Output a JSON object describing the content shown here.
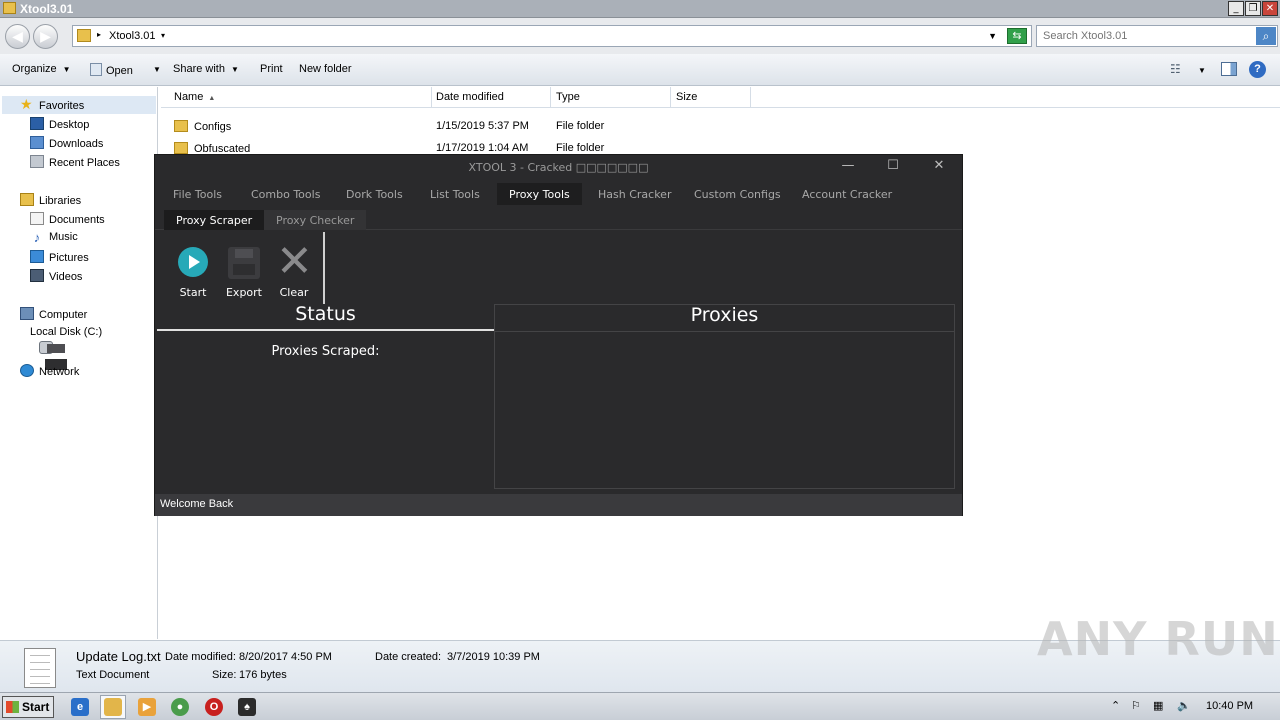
{
  "explorer": {
    "title": "Xtool3.01",
    "winbtns": {
      "minimize": "_",
      "restore": "❐",
      "close": "✕"
    },
    "address": {
      "path": "Xtool3.01",
      "search_placeholder": "Search Xtool3.01"
    },
    "command_bar": {
      "organize": "Organize",
      "open": "Open",
      "share_with": "Share with",
      "print": "Print",
      "new_folder": "New folder"
    },
    "nav": {
      "favorites": "Favorites",
      "desktop": "Desktop",
      "downloads": "Downloads",
      "recent_places": "Recent Places",
      "libraries": "Libraries",
      "documents": "Documents",
      "music": "Music",
      "pictures": "Pictures",
      "videos": "Videos",
      "computer": "Computer",
      "local_disk": "Local Disk (C:)",
      "network": "Network"
    },
    "columns": {
      "name": "Name",
      "date_modified": "Date modified",
      "type": "Type",
      "size": "Size"
    },
    "files": [
      {
        "name": "Configs",
        "date": "1/15/2019 5:37 PM",
        "type": "File folder"
      },
      {
        "name": "Obfuscated",
        "date": "1/17/2019 1:04 AM",
        "type": "File folder"
      }
    ],
    "details": {
      "filename": "Update Log.txt",
      "date_modified_label": "Date modified:",
      "date_modified": "8/20/2017 4:50 PM",
      "date_created_label": "Date created:",
      "date_created": "3/7/2019 10:39 PM",
      "filetype": "Text Document",
      "size_label": "Size:",
      "size": "176 bytes"
    }
  },
  "app": {
    "title": "XTOOL 3 - Cracked □□□□□□□",
    "controls": {
      "minimize": "—",
      "maximize": "☐",
      "close": "✕"
    },
    "tabs": [
      "File Tools",
      "Combo Tools",
      "Dork Tools",
      "List Tools",
      "Proxy Tools",
      "Hash Cracker",
      "Custom Configs",
      "Account Cracker"
    ],
    "active_tab": "Proxy Tools",
    "subtabs": [
      "Proxy Scraper",
      "Proxy Checker"
    ],
    "toolbar": {
      "start": "Start",
      "export": "Export",
      "clear": "Clear"
    },
    "status": {
      "heading": "Status",
      "scraped_label": "Proxies Scraped:"
    },
    "proxies": {
      "heading": "Proxies"
    },
    "statusbar": "Welcome Back"
  },
  "taskbar": {
    "start": "Start",
    "clock": "10:40 PM"
  },
  "watermark": "ANY RUN",
  "icons": {
    "nav_back": "arrow-left-icon",
    "nav_forward": "arrow-right-icon",
    "refresh": "refresh-icon",
    "search": "search-icon",
    "help": "help-icon"
  }
}
